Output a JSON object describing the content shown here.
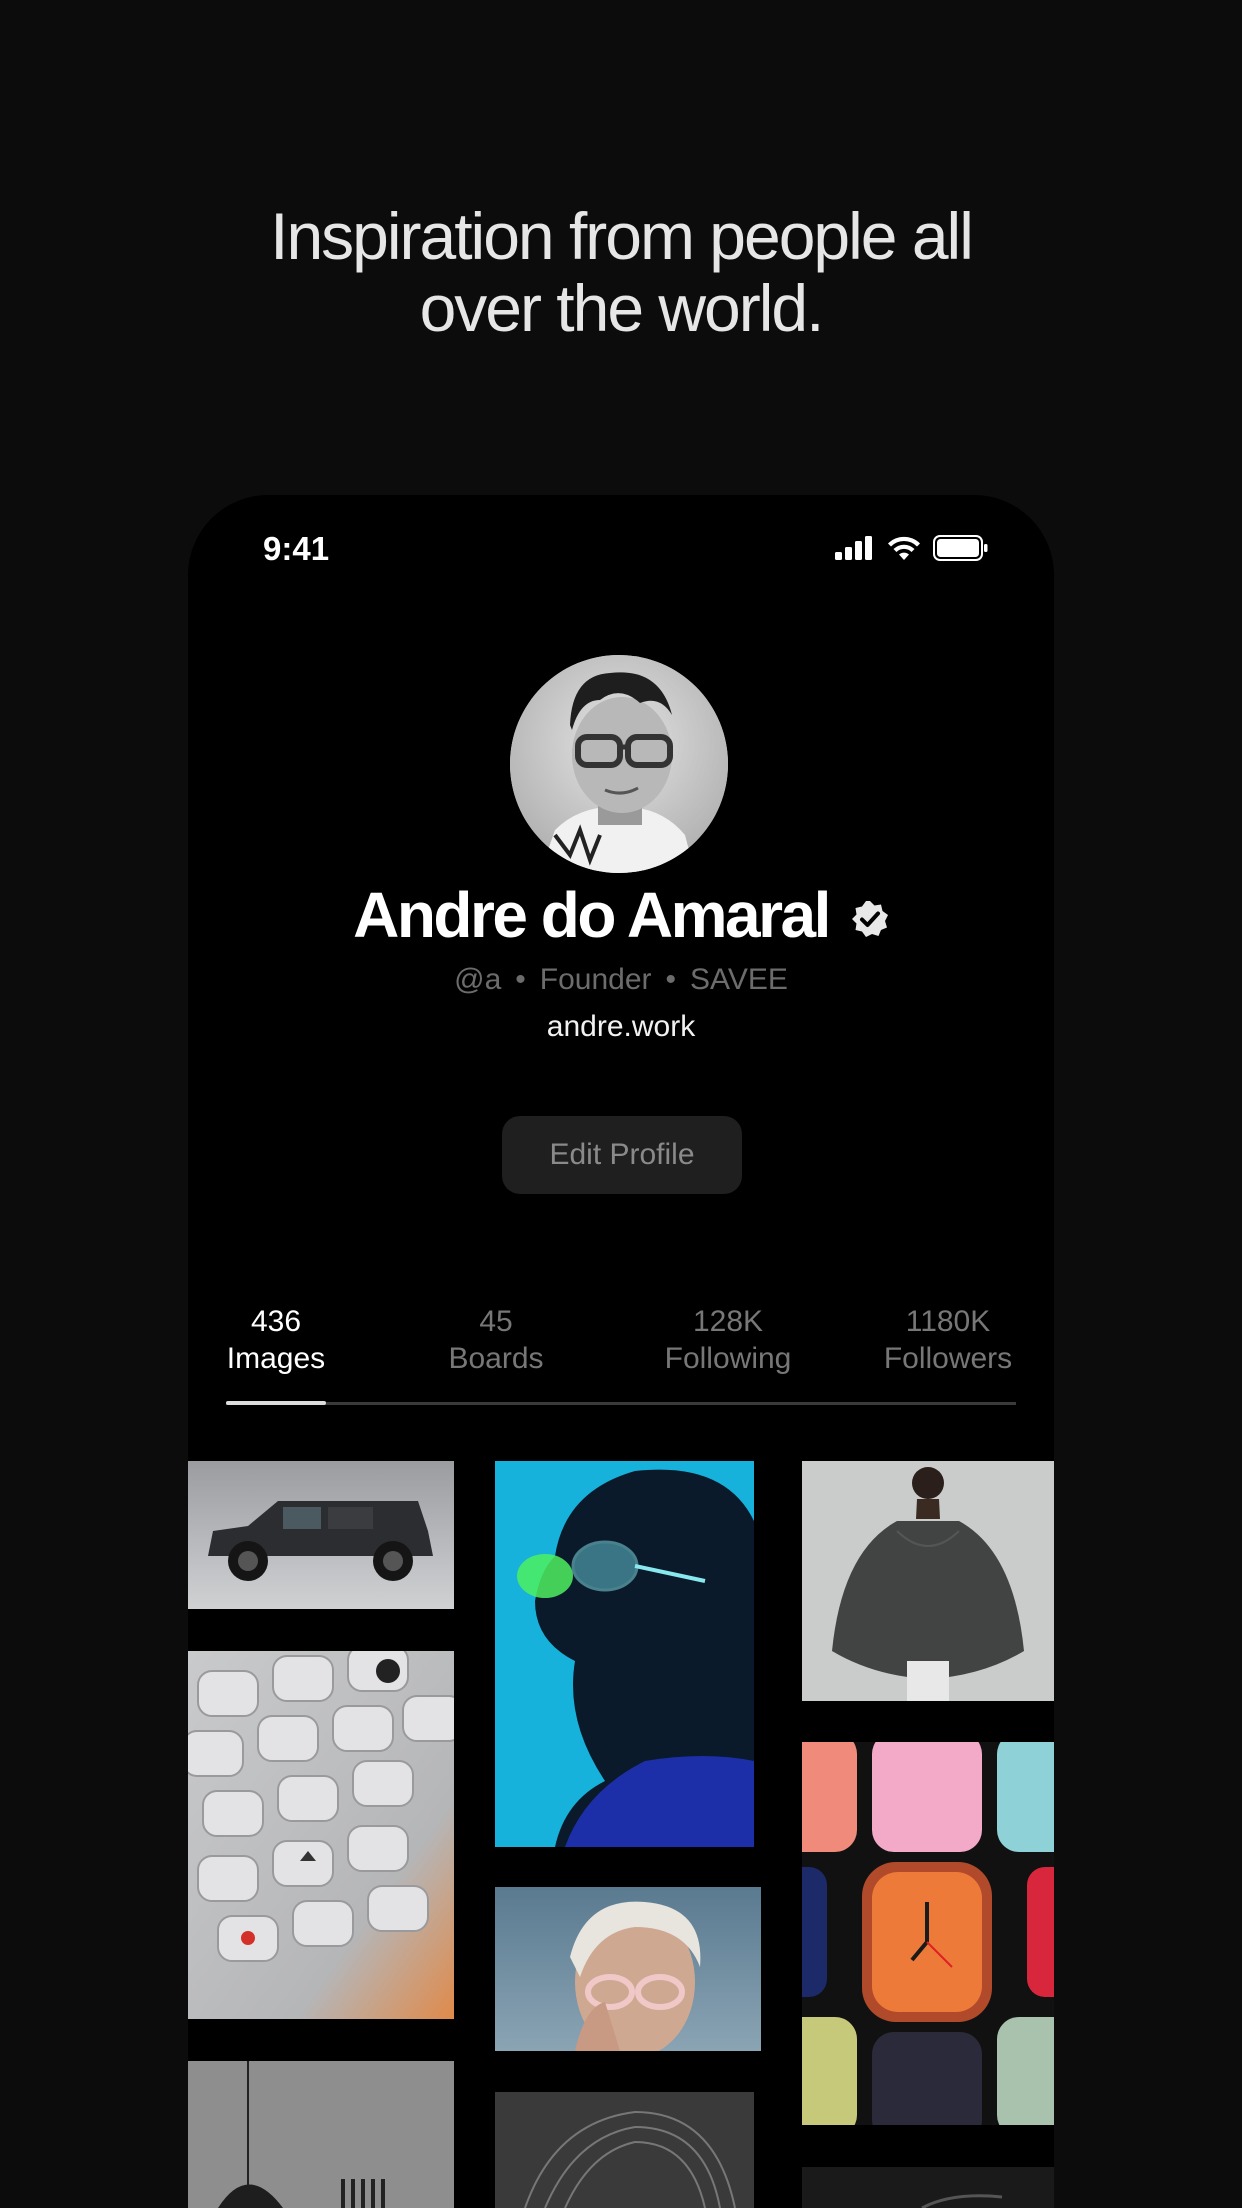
{
  "headline": {
    "line1": "Inspiration from people all",
    "line2": "over the world."
  },
  "status_bar": {
    "time": "9:41",
    "icons": [
      "cellular-signal-icon",
      "wifi-icon",
      "battery-icon"
    ]
  },
  "profile": {
    "name": "Andre do Amaral",
    "verified_icon": "verified-badge-icon",
    "handle": "@a",
    "role": "Founder",
    "company": "SAVEE",
    "separator": "•",
    "website": "andre.work",
    "edit_button_label": "Edit Profile"
  },
  "stats": [
    {
      "count": "436",
      "label": "Images",
      "active": true
    },
    {
      "count": "45",
      "label": "Boards",
      "active": false
    },
    {
      "count": "128K",
      "label": "Following",
      "active": false
    },
    {
      "count": "1180K",
      "label": "Followers",
      "active": false
    }
  ],
  "grid_images": [
    "dark-suv-photo",
    "calculator-keypad-photo",
    "light-fixture-photo",
    "woman-sunglasses-blue-photo",
    "elderly-woman-glasses-photo",
    "black-white-hair-photo",
    "sheer-jacket-fashion-photo",
    "watch-straps-photo"
  ],
  "colors": {
    "page_background": "#0c0c0d",
    "phone_background": "#000000",
    "button_background": "#1f1f1f",
    "muted_text": "#777777"
  }
}
